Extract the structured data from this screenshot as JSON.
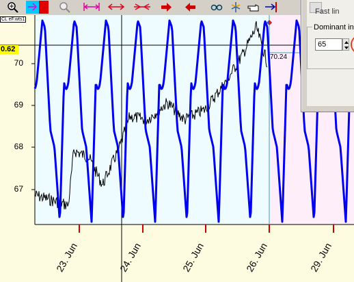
{
  "toolbar": {
    "buttons": [
      {
        "name": "zoom-in-button",
        "icon": "magnifier-plus-icon"
      },
      {
        "name": "pointer-tool-button",
        "icon": "cursor-arrow-icon"
      },
      {
        "name": "color-button",
        "icon": "red-square-icon"
      },
      {
        "name": "zoom-out-button",
        "icon": "magnifier-icon"
      },
      {
        "name": "measure-range-button",
        "icon": "bracket-arrows-icon"
      },
      {
        "name": "expand-button",
        "icon": "double-arrow-icon"
      },
      {
        "name": "compress-button",
        "icon": "converge-arrows-icon"
      },
      {
        "name": "scroll-right-button",
        "icon": "red-arrow-right-icon"
      },
      {
        "name": "scroll-left-button",
        "icon": "red-arrow-left-icon"
      },
      {
        "name": "spectacles-button",
        "icon": "glasses-icon"
      },
      {
        "name": "fork-button",
        "icon": "fork-tool-icon"
      },
      {
        "name": "hand-button",
        "icon": "pointing-hand-icon"
      },
      {
        "name": "goto-end-button",
        "icon": "goto-end-icon"
      }
    ]
  },
  "chart": {
    "series_name": "CL eF.wts1",
    "current_value": "0.62",
    "last_price": "70.24",
    "y_ticks": [
      "70",
      "69",
      "68",
      "67"
    ],
    "x_ticks": [
      "23. Jun",
      "24. Jun",
      "25. Jun",
      "26. Jun",
      "29. Jun"
    ],
    "colors": {
      "plot_bg": "#eefbff",
      "future_bg": "#fdeefa",
      "cycle_line": "#0000ee",
      "price_line": "#000000",
      "tick_marker": "#ff0000"
    }
  },
  "panel": {
    "fast_label": "Fast lin",
    "dominant_label": "Dominant int",
    "dominant_value": "65"
  }
}
